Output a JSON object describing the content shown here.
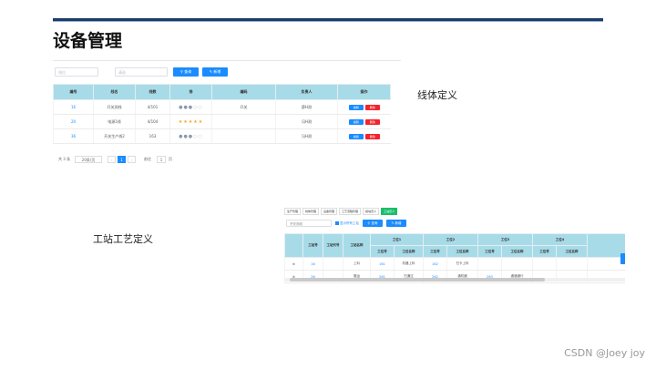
{
  "slide": {
    "title": "设备管理",
    "watermark": "CSDN @Joey joy"
  },
  "labels": {
    "line_def": "线体定义",
    "station_def": "工站工艺定义"
  },
  "panel1": {
    "input1_placeholder": "线位",
    "input2_placeholder": "请选",
    "search_label": "查询",
    "add_label": "新增",
    "columns": [
      "编号",
      "线名",
      "线数",
      "排",
      "编码",
      "负责人",
      "操作"
    ],
    "rows": [
      {
        "id": "16",
        "name": "开关测线",
        "count": "4/101",
        "rating": 3,
        "code": "开关",
        "owner": "薛H测"
      },
      {
        "id": "20",
        "name": "电源1线",
        "count": "4/104",
        "rating": 5,
        "code": "",
        "owner": "冯H测"
      },
      {
        "id": "36",
        "name": "开关生产线2",
        "count": "163",
        "rating": 3,
        "code": "",
        "owner": "冯H测"
      }
    ],
    "edit_label": "编辑",
    "delete_label": "删除",
    "pager": {
      "total": "共 3 条",
      "page_size": "20条/页",
      "current": "1",
      "goto_label": "前往",
      "goto_value": "1",
      "page_unit": "页"
    }
  },
  "panel2": {
    "tabs": [
      {
        "label": "生产管理",
        "active": false
      },
      {
        "label": "线体管理",
        "active": false
      },
      {
        "label": "设备管理",
        "active": false
      },
      {
        "label": "工艺流程管理",
        "active": false
      },
      {
        "label": "模块定义",
        "active": false
      },
      {
        "label": "工站定义",
        "active": true
      }
    ],
    "select_placeholder": "开关测线",
    "checkbox_label": "显示所有工站",
    "search_label": "查询",
    "add_label": "新增",
    "fixed_columns": [
      "工站号",
      "工站代号",
      "工站名称"
    ],
    "group_header": "工位",
    "group_count": 4,
    "sub_columns": [
      "工位号",
      "工位名称"
    ],
    "rows": [
      {
        "no": "16",
        "code": "",
        "name": "上料",
        "cells": [
          "161",
          "机器上料",
          "162",
          "扫卡上料",
          "",
          "",
          "",
          ""
        ]
      },
      {
        "no": "26",
        "code": "",
        "name": "搬运",
        "cells": [
          "261",
          "扫通过",
          "262",
          "通机器",
          "263",
          "通通通行",
          "",
          ""
        ]
      }
    ]
  },
  "colors": {
    "header": "#a8dbe8",
    "primary": "#1a8cff",
    "danger": "#f5222d",
    "success": "#19be6b",
    "title_bar": "#1b3d66"
  }
}
